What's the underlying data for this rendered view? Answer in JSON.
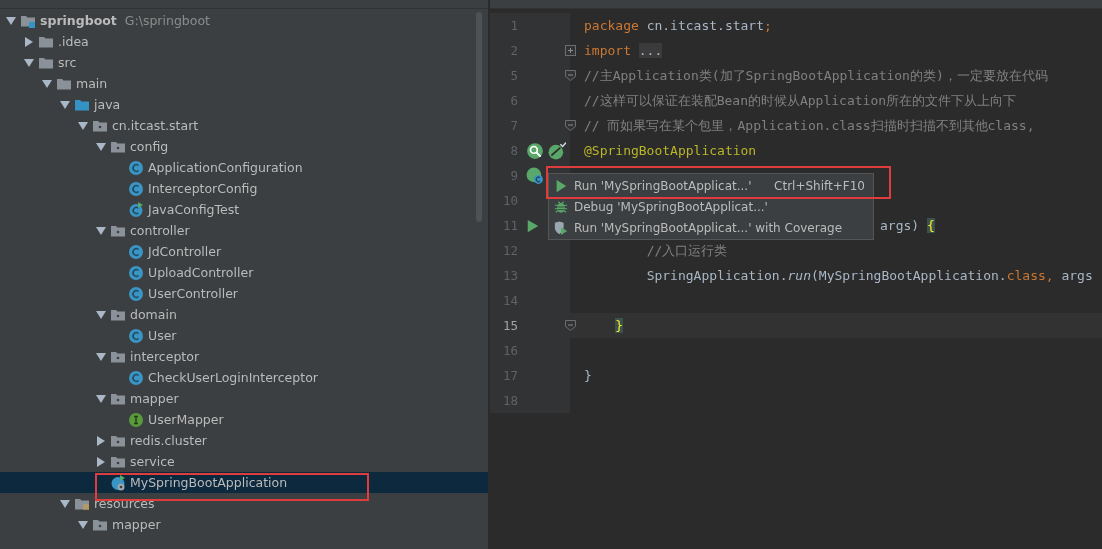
{
  "project_tree": {
    "items": [
      {
        "label": "springboot",
        "kind": "module",
        "path": "G:\\springboot",
        "expanded": true,
        "selected": false,
        "children": [
          {
            "label": ".idea",
            "kind": "folder",
            "expanded": false,
            "selected": false
          },
          {
            "label": "src",
            "kind": "folder",
            "expanded": true,
            "selected": false,
            "children": [
              {
                "label": "main",
                "kind": "folder",
                "expanded": true,
                "selected": false,
                "children": [
                  {
                    "label": "java",
                    "kind": "source-folder",
                    "expanded": true,
                    "selected": false,
                    "children": [
                      {
                        "label": "cn.itcast.start",
                        "kind": "package",
                        "expanded": true,
                        "selected": false,
                        "children": [
                          {
                            "label": "config",
                            "kind": "package",
                            "expanded": true,
                            "selected": false,
                            "children": [
                              {
                                "label": "ApplicationConfiguration",
                                "kind": "class",
                                "selected": false
                              },
                              {
                                "label": "InterceptorConfig",
                                "kind": "class",
                                "selected": false
                              },
                              {
                                "label": "JavaConfigTest",
                                "kind": "runnable-class",
                                "selected": false
                              }
                            ]
                          },
                          {
                            "label": "controller",
                            "kind": "package",
                            "expanded": true,
                            "selected": false,
                            "children": [
                              {
                                "label": "JdController",
                                "kind": "class",
                                "selected": false
                              },
                              {
                                "label": "UploadController",
                                "kind": "class",
                                "selected": false
                              },
                              {
                                "label": "UserController",
                                "kind": "class",
                                "selected": false
                              }
                            ]
                          },
                          {
                            "label": "domain",
                            "kind": "package",
                            "expanded": true,
                            "selected": false,
                            "children": [
                              {
                                "label": "User",
                                "kind": "class",
                                "selected": false
                              }
                            ]
                          },
                          {
                            "label": "interceptor",
                            "kind": "package",
                            "expanded": true,
                            "selected": false,
                            "children": [
                              {
                                "label": "CheckUserLoginInterceptor",
                                "kind": "class",
                                "selected": false
                              }
                            ]
                          },
                          {
                            "label": "mapper",
                            "kind": "package",
                            "expanded": true,
                            "selected": false,
                            "children": [
                              {
                                "label": "UserMapper",
                                "kind": "interface",
                                "selected": false
                              }
                            ]
                          },
                          {
                            "label": "redis.cluster",
                            "kind": "package",
                            "expanded": false,
                            "selected": false
                          },
                          {
                            "label": "service",
                            "kind": "package",
                            "expanded": false,
                            "selected": false
                          },
                          {
                            "label": "MySpringBootApplication",
                            "kind": "boot-class",
                            "selected": true
                          }
                        ]
                      }
                    ]
                  },
                  {
                    "label": "resources",
                    "kind": "resources",
                    "expanded": true,
                    "selected": false,
                    "children": [
                      {
                        "label": "mapper",
                        "kind": "package",
                        "expanded": true,
                        "selected": false
                      }
                    ]
                  }
                ]
              }
            ]
          }
        ]
      }
    ]
  },
  "editor": {
    "lines": [
      {
        "number": "1",
        "current": false,
        "tokens": [
          {
            "kind": "keyword",
            "text": "package"
          },
          {
            "kind": "plain",
            "text": " cn.itcast.start"
          },
          {
            "kind": "keyword",
            "text": ";"
          }
        ]
      },
      {
        "number": "2",
        "current": false,
        "expanded": false,
        "tokens": [
          {
            "kind": "keyword",
            "text": "import"
          },
          {
            "kind": "folded",
            "text": " ..."
          }
        ]
      },
      {
        "number": "5",
        "current": false,
        "expanded": true,
        "tokens": [
          {
            "kind": "comment",
            "text": "//主Application类(加了SpringBootApplication的类)，一定要放在代码"
          }
        ]
      },
      {
        "number": "6",
        "current": false,
        "tokens": [
          {
            "kind": "comment",
            "text": "//这样可以保证在装配Bean的时候从Application所在的文件下从上向下"
          }
        ]
      },
      {
        "number": "7",
        "current": false,
        "expanded": true,
        "tokens": [
          {
            "kind": "comment",
            "text": "// 而如果写在某个包里，Application.class扫描时扫描不到其他class,"
          }
        ]
      },
      {
        "number": "8",
        "current": false,
        "markers": [
          {
            "kind": "bean-search"
          },
          {
            "kind": "spring-check"
          }
        ],
        "tokens": [
          {
            "kind": "annotation",
            "text": "@SpringBootApplication"
          }
        ]
      },
      {
        "number": "9",
        "current": false,
        "markers": [
          {
            "kind": "bean"
          }
        ]
      },
      {
        "number": "10",
        "current": false
      },
      {
        "number": "11",
        "current": false,
        "covered": true,
        "markers": [
          {
            "kind": "run"
          }
        ],
        "tokens": [
          {
            "kind": "plain",
            "text": "args) "
          },
          {
            "kind": "brace",
            "text": "{"
          }
        ]
      },
      {
        "number": "12",
        "current": false,
        "tokens": [
          {
            "kind": "comment",
            "text": "        //入口运行类"
          }
        ]
      },
      {
        "number": "13",
        "current": false,
        "tokens": [
          {
            "kind": "plain",
            "text": "        SpringApplication."
          },
          {
            "kind": "italic",
            "text": "run"
          },
          {
            "kind": "plain",
            "text": "(MySpringBootApplication."
          },
          {
            "kind": "keyword",
            "text": "class,"
          },
          {
            "kind": "plain",
            "text": " args"
          }
        ]
      },
      {
        "number": "14",
        "current": false
      },
      {
        "number": "15",
        "current": true,
        "expanded": true,
        "tokens": [
          {
            "kind": "brace",
            "text": "    }"
          }
        ]
      },
      {
        "number": "16",
        "current": false
      },
      {
        "number": "17",
        "current": false,
        "tokens": [
          {
            "kind": "plain",
            "text": "}"
          }
        ]
      },
      {
        "number": "18",
        "current": false
      }
    ]
  },
  "context_menu": {
    "items": [
      {
        "kind": "run",
        "label": "Run 'MySpringBootApplicat...'",
        "shortcut": "Ctrl+Shift+F10",
        "selected": false
      },
      {
        "kind": "debug",
        "label": "Debug 'MySpringBootApplicat...'",
        "selected": false
      },
      {
        "kind": "coverage",
        "label": "Run 'MySpringBootApplicat...' with Coverage",
        "selected": false
      }
    ]
  }
}
